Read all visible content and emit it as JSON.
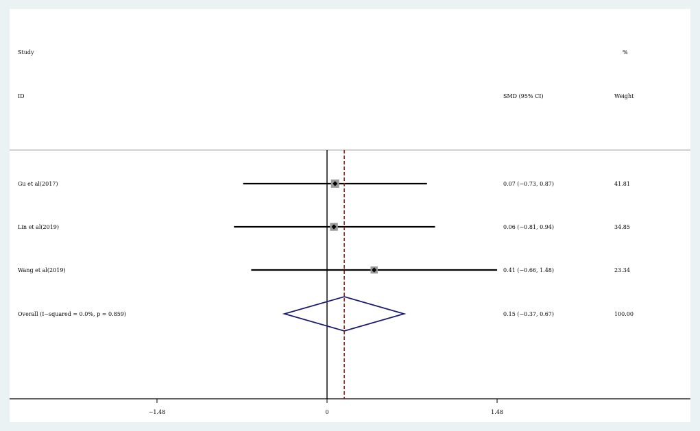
{
  "header": {
    "study": "Study",
    "id": "ID",
    "effect": "SMD (95% CI)",
    "pct": "%",
    "weight": "Weight"
  },
  "chart_data": {
    "type": "forest",
    "xlim": [
      -2.3,
      2.1
    ],
    "x_ticks": [
      {
        "value": -1.48,
        "label": "−1.48"
      },
      {
        "value": 0,
        "label": "0"
      },
      {
        "value": 1.48,
        "label": "1.48"
      }
    ],
    "null_line": 0,
    "overall_line": 0.15,
    "studies": [
      {
        "label": "Gu et al(2017)",
        "es": 0.07,
        "lo": -0.73,
        "hi": 0.87,
        "ci_text": "0.07 (−0.73, 0.87)",
        "weight": "41.81"
      },
      {
        "label": "Lin et al(2019)",
        "es": 0.06,
        "lo": -0.81,
        "hi": 0.94,
        "ci_text": "0.06 (−0.81, 0.94)",
        "weight": "34.85"
      },
      {
        "label": "Wang et al(2019)",
        "es": 0.41,
        "lo": -0.66,
        "hi": 1.48,
        "ci_text": "0.41 (−0.66, 1.48)",
        "weight": "23.34"
      }
    ],
    "overall": {
      "label": "Overall  (I−squared = 0.0%, p = 0.859)",
      "es": 0.15,
      "lo": -0.37,
      "hi": 0.67,
      "ci_text": "0.15 (−0.37, 0.67)",
      "weight": "100.00"
    },
    "colors": {
      "ci_line": "#000000",
      "box": "#9a9a9a",
      "point": "#000000",
      "diamond": "#1a1a6e",
      "overall_line": "#a01010",
      "header_rule": "#b4b4b4"
    }
  }
}
